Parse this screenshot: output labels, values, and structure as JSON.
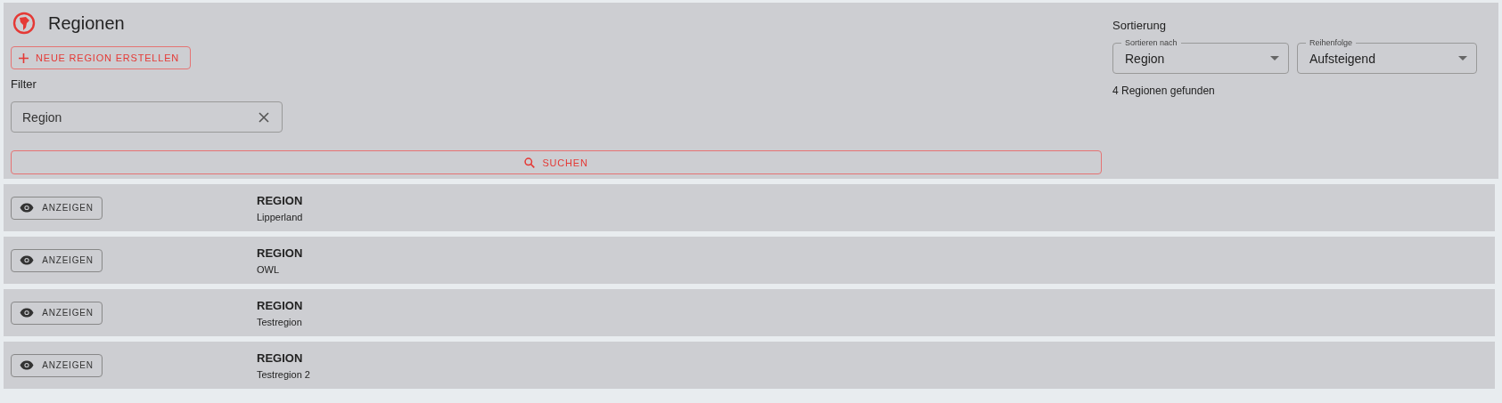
{
  "header": {
    "title": "Regionen"
  },
  "create_button": {
    "label": "NEUE REGION ERSTELLEN"
  },
  "filter": {
    "heading": "Filter",
    "field": {
      "value": "Region"
    }
  },
  "search_button": {
    "label": "SUCHEN"
  },
  "sorting": {
    "heading": "Sortierung",
    "selects": [
      {
        "label": "Sortieren nach",
        "value": "Region"
      },
      {
        "label": "Reihenfolge",
        "value": "Aufsteigend"
      }
    ],
    "result_count": "4 Regionen gefunden"
  },
  "rows": [
    {
      "button": "ANZEIGEN",
      "label": "REGION",
      "value": "Lipperland"
    },
    {
      "button": "ANZEIGEN",
      "label": "REGION",
      "value": "OWL"
    },
    {
      "button": "ANZEIGEN",
      "label": "REGION",
      "value": "Testregion"
    },
    {
      "button": "ANZEIGEN",
      "label": "REGION",
      "value": "Testregion 2"
    }
  ]
}
